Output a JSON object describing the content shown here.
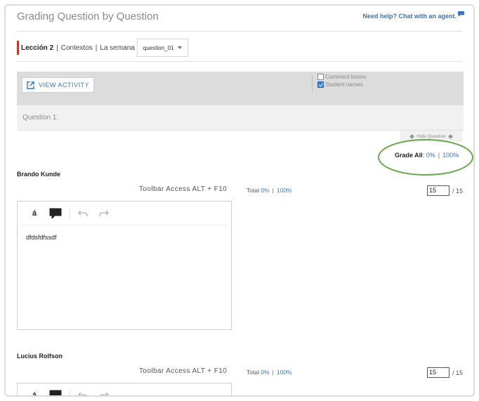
{
  "header": {
    "title": "Grading Question by Question",
    "help_link": "Need help? Chat with an agent."
  },
  "breadcrumb": {
    "lesson": "Lección 2",
    "separator": "|",
    "section": "Contextos",
    "subsection": "La semana",
    "question_select": "question_01"
  },
  "activity_bar": {
    "view_activity": "VIEW ACTIVITY",
    "options": [
      {
        "label": "Comment boxes",
        "checked": false
      },
      {
        "label": "Student names",
        "checked": true
      }
    ]
  },
  "question": {
    "label": "Question 1:",
    "hide_label": "Hide Question"
  },
  "grade_all": {
    "label": "Grade All",
    "zero": "0%",
    "hundred": "100%",
    "highlight_color": "#6aa84f"
  },
  "students": [
    {
      "name": "Brando Kunde",
      "toolbar_hint": "Toolbar Access ALT + F10",
      "total_label": "Total",
      "total_zero": "0%",
      "total_hundred": "100%",
      "score": "15",
      "max": "/ 15",
      "response": "dfdsfdfssdf",
      "editor_buttons": [
        "á",
        "comment-icon",
        "undo-icon",
        "redo-icon"
      ]
    },
    {
      "name": "Lucius Rolfson",
      "toolbar_hint": "Toolbar Access ALT + F10",
      "total_label": "Total",
      "total_zero": "0%",
      "total_hundred": "100%",
      "score": "15",
      "max": "/ 15",
      "response": "",
      "editor_buttons": [
        "á",
        "comment-icon",
        "undo-icon",
        "redo-icon"
      ]
    }
  ],
  "colors": {
    "accent": "#3d74b8",
    "lesson_marker": "#c0392b",
    "bar_gray": "#dcdcdc"
  }
}
